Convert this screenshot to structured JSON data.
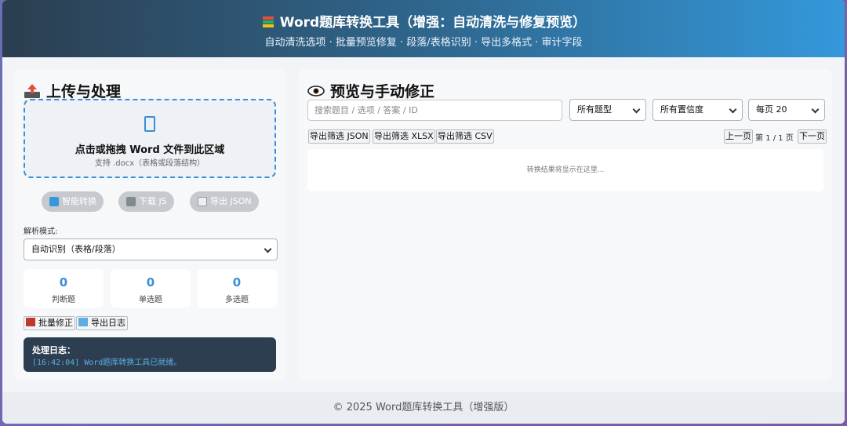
{
  "header": {
    "title": "Word题库转换工具（增强：自动清洗与修复预览）",
    "subtitle": "自动清洗选项 · 批量预览修复 · 段落/表格识别 · 导出多格式 · 审计字段"
  },
  "upload": {
    "title": "上传与处理",
    "dropzone_main": "点击或拖拽 Word 文件到此区域",
    "dropzone_hint": "支持 .docx（表格或段落结构）",
    "buttons": {
      "smart_convert": "智能转换",
      "download_js": "下载 JS",
      "export_json": "导出 JSON"
    },
    "mode_label": "解析模式:",
    "mode_value": "自动识别（表格/段落）",
    "stats": [
      {
        "value": "0",
        "label": "判断题"
      },
      {
        "value": "0",
        "label": "单选题"
      },
      {
        "value": "0",
        "label": "多选题"
      }
    ],
    "batch_fix": "批量修正",
    "export_log": "导出日志",
    "log_title": "处理日志：",
    "log_line": "[16:42:04] Word题库转换工具已就绪。"
  },
  "preview": {
    "title": "预览与手动修正",
    "search_placeholder": "搜索题目 / 选项 / 答案 / ID",
    "type_filter": "所有题型",
    "confidence_filter": "所有置信度",
    "page_size": "每页 20",
    "export_json": "导出筛选 JSON",
    "export_xlsx": "导出筛选 XLSX",
    "export_csv": "导出筛选 CSV",
    "prev": "上一页",
    "page_info": "第 1 / 1 页",
    "next": "下一页",
    "empty": "转换结果将显示在这里..."
  },
  "footer": {
    "text": "© 2025 Word题库转换工具（增强版）"
  },
  "colors": {
    "accent": "#3498db",
    "header_dark": "#2c3e50",
    "log_text": "#5dade2"
  }
}
